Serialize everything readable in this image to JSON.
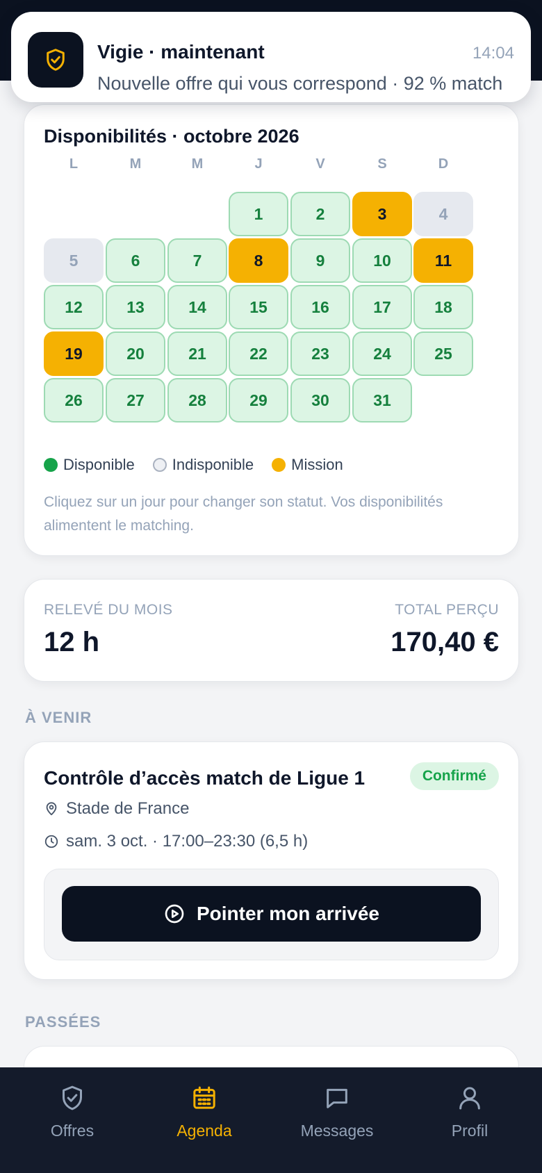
{
  "notification": {
    "app": "Vigie · maintenant",
    "time": "14:04",
    "body": "Nouvelle offre qui vous correspond · 92 % match",
    "icon": "shield-check-icon"
  },
  "calendar": {
    "title": "Disponibilités · octobre 2026",
    "weekdays": [
      "L",
      "M",
      "M",
      "J",
      "V",
      "S",
      "D"
    ],
    "first_weekday_index": 3,
    "days": [
      {
        "day": "1",
        "status": "available"
      },
      {
        "day": "2",
        "status": "available"
      },
      {
        "day": "3",
        "status": "mission"
      },
      {
        "day": "4",
        "status": "unavailable"
      },
      {
        "day": "5",
        "status": "unavailable"
      },
      {
        "day": "6",
        "status": "available"
      },
      {
        "day": "7",
        "status": "available"
      },
      {
        "day": "8",
        "status": "mission"
      },
      {
        "day": "9",
        "status": "available"
      },
      {
        "day": "10",
        "status": "available"
      },
      {
        "day": "11",
        "status": "mission"
      },
      {
        "day": "12",
        "status": "available"
      },
      {
        "day": "13",
        "status": "available"
      },
      {
        "day": "14",
        "status": "available"
      },
      {
        "day": "15",
        "status": "available"
      },
      {
        "day": "16",
        "status": "available"
      },
      {
        "day": "17",
        "status": "available"
      },
      {
        "day": "18",
        "status": "available"
      },
      {
        "day": "19",
        "status": "mission"
      },
      {
        "day": "20",
        "status": "available"
      },
      {
        "day": "21",
        "status": "available"
      },
      {
        "day": "22",
        "status": "available"
      },
      {
        "day": "23",
        "status": "available"
      },
      {
        "day": "24",
        "status": "available"
      },
      {
        "day": "25",
        "status": "available"
      },
      {
        "day": "26",
        "status": "available"
      },
      {
        "day": "27",
        "status": "available"
      },
      {
        "day": "28",
        "status": "available"
      },
      {
        "day": "29",
        "status": "available"
      },
      {
        "day": "30",
        "status": "available"
      },
      {
        "day": "31",
        "status": "available"
      }
    ],
    "legend": {
      "available": "Disponible",
      "unavailable": "Indisponible",
      "mission": "Mission"
    },
    "hint": "Cliquez sur un jour pour changer son statut. Vos disponibilités alimentent le matching."
  },
  "stats": {
    "month_label": "RELEVÉ DU MOIS",
    "month_value": "12 h",
    "total_label": "TOTAL PERÇU",
    "total_value": "170,40 €"
  },
  "upcoming": {
    "section_title": "À VENIR",
    "mission": {
      "title": "Contrôle d’accès match de Ligue 1",
      "status": "Confirmé",
      "location": "Stade de France",
      "schedule": "sam. 3 oct. · 17:00–23:30 (6,5 h)",
      "action_label": "Pointer mon arrivée"
    }
  },
  "past": {
    "section_title": "PASSÉES"
  },
  "nav": {
    "items": [
      {
        "label": "Offres",
        "icon": "shield-check-icon",
        "active": false
      },
      {
        "label": "Agenda",
        "icon": "calendar-icon",
        "active": true
      },
      {
        "label": "Messages",
        "icon": "message-icon",
        "active": false
      },
      {
        "label": "Profil",
        "icon": "user-icon",
        "active": false
      }
    ]
  },
  "colors": {
    "accent": "#f5b102",
    "available": "#16a34a",
    "dark": "#0b1220"
  }
}
